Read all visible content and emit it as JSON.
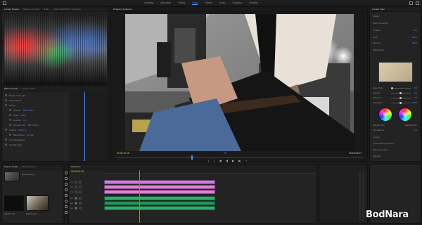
{
  "workspaces": [
    "Learning",
    "Assembly",
    "Editing",
    "Color",
    "Effects",
    "Audio",
    "Graphics",
    "Libraries"
  ],
  "active_workspace": "Color",
  "scopes_panel": {
    "tabs": [
      "Lumetri Scopes",
      "Source: (no clips)",
      "Audio",
      "Audio Track Mixer: Sequence"
    ]
  },
  "effects_panel": {
    "tabs": [
      "Effect Controls",
      "Lumetri Color"
    ],
    "rows": [
      {
        "label": "Master * Clip.mp4",
        "value": ""
      },
      {
        "label": "Video Effects",
        "value": ""
      },
      {
        "label": "Motion",
        "value": ""
      },
      {
        "label": "Position",
        "value": "960.0 540.0"
      },
      {
        "label": "Scale",
        "value": "100.0"
      },
      {
        "label": "Rotation",
        "value": "0.0"
      },
      {
        "label": "Anchor Point",
        "value": "960.0 540.0"
      },
      {
        "label": "Opacity",
        "value": "100.0 %"
      },
      {
        "label": "Blend Mode",
        "value": "Normal"
      },
      {
        "label": "Time Remapping",
        "value": ""
      },
      {
        "label": "Lumetri Color",
        "value": ""
      }
    ]
  },
  "program_monitor": {
    "title": "Program: Sequence",
    "timecode_current": "00:00:12:18",
    "fit": "Fit",
    "timecode_duration": "00:01:04:07",
    "transport": [
      "{",
      "}",
      "|◀",
      "◀",
      "▶",
      "▶|",
      "+"
    ]
  },
  "lumetri": {
    "header": "Lumetri Color",
    "rows": [
      {
        "k": "Master",
        "v": ""
      },
      {
        "k": "Basic Correction",
        "v": ""
      },
      {
        "k": "Creative",
        "v": "On"
      },
      {
        "k": "Look",
        "v": "None"
      },
      {
        "k": "Intensity",
        "v": "100.0"
      },
      {
        "k": "Adjustments",
        "v": ""
      },
      {
        "k": "Faded Film",
        "v": "0.0"
      },
      {
        "k": "Sharpen",
        "v": "0.0"
      },
      {
        "k": "Vibrance",
        "v": "0.0"
      },
      {
        "k": "Saturation",
        "v": "100.0"
      },
      {
        "k": "Shadow Tint",
        "v": ""
      },
      {
        "k": "Highlight Tint",
        "v": ""
      },
      {
        "k": "Tint Balance",
        "v": "0.0"
      },
      {
        "k": "Curves",
        "v": ""
      },
      {
        "k": "Color Wheels & Match",
        "v": ""
      },
      {
        "k": "HSL Secondary",
        "v": ""
      },
      {
        "k": "Vignette",
        "v": ""
      }
    ]
  },
  "project_panel": {
    "tabs": [
      "Project: Guitar",
      "Media Browser"
    ],
    "items": [
      "Guitar.prproj",
      "Clip01.mp4",
      "Clip02.mp4"
    ]
  },
  "timeline": {
    "tab": "Sequence",
    "timecode": "00:00:12:18",
    "tracks": [
      {
        "name": "V3"
      },
      {
        "name": "V2"
      },
      {
        "name": "V1"
      },
      {
        "name": "A1"
      },
      {
        "name": "A2"
      },
      {
        "name": "A3"
      }
    ]
  },
  "watermark": "BodNara",
  "colors": {
    "accent": "#4d8cff",
    "timecode": "#d6d040",
    "video_clip": "#e07fd9",
    "audio_clip": "#2fae6e"
  }
}
